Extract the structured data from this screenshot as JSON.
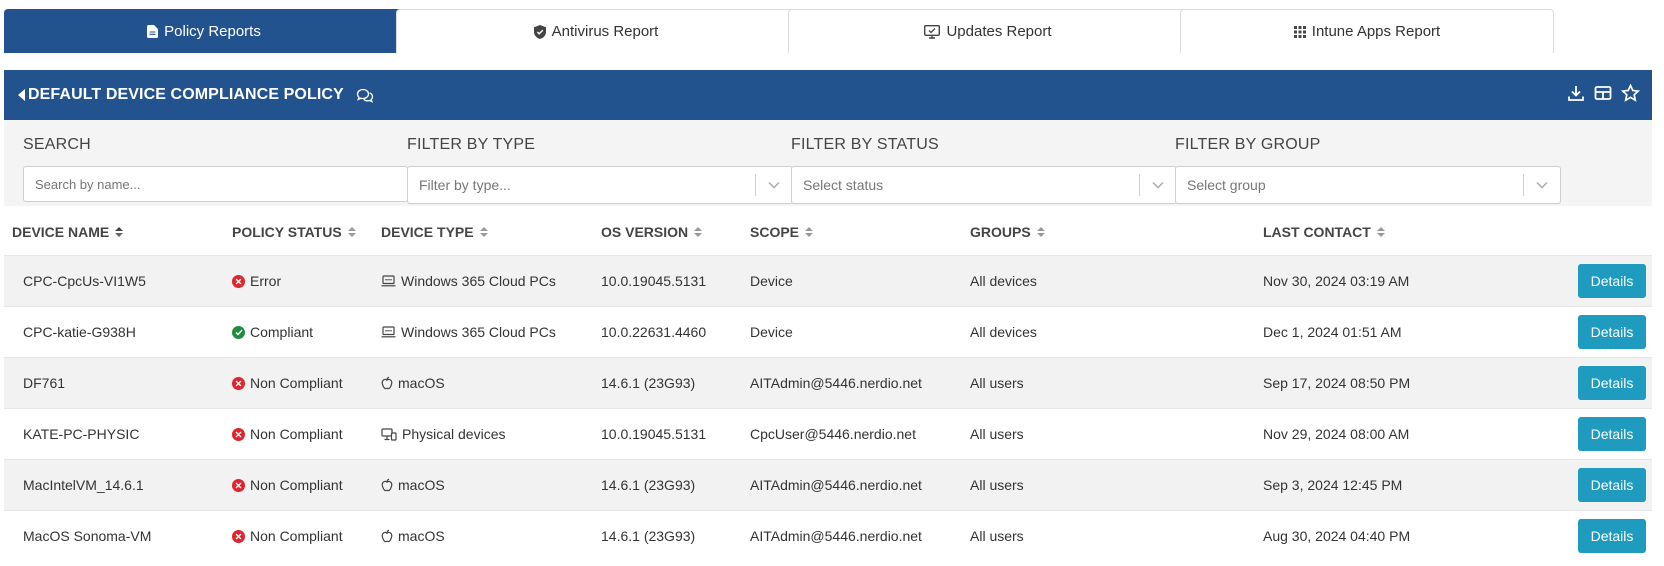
{
  "tabs": [
    {
      "label": "Policy Reports",
      "icon": "file-icon",
      "active": true
    },
    {
      "label": "Antivirus Report",
      "icon": "shield-icon",
      "active": false
    },
    {
      "label": "Updates Report",
      "icon": "monitor-icon",
      "active": false
    },
    {
      "label": "Intune Apps Report",
      "icon": "grid-icon",
      "active": false
    }
  ],
  "header": {
    "title": "DEFAULT DEVICE COMPLIANCE POLICY"
  },
  "filters": {
    "search_label": "SEARCH",
    "search_placeholder": "Search by name...",
    "type_label": "FILTER BY TYPE",
    "type_placeholder": "Filter by type...",
    "status_label": "FILTER BY STATUS",
    "status_placeholder": "Select status",
    "group_label": "FILTER BY GROUP",
    "group_placeholder": "Select group"
  },
  "table": {
    "columns": [
      "DEVICE NAME",
      "POLICY STATUS",
      "DEVICE TYPE",
      "OS VERSION",
      "SCOPE",
      "GROUPS",
      "LAST CONTACT"
    ],
    "details_label": "Details",
    "rows": [
      {
        "name": "CPC-CpcUs-VI1W5",
        "status": "Error",
        "status_kind": "error",
        "type": "Windows 365 Cloud PCs",
        "type_icon": "laptop-icon",
        "os": "10.0.19045.5131",
        "scope": "Device",
        "groups": "All devices",
        "last": "Nov 30, 2024 03:19 AM"
      },
      {
        "name": "CPC-katie-G938H",
        "status": "Compliant",
        "status_kind": "ok",
        "type": "Windows 365 Cloud PCs",
        "type_icon": "laptop-icon",
        "os": "10.0.22631.4460",
        "scope": "Device",
        "groups": "All devices",
        "last": "Dec 1, 2024 01:51 AM"
      },
      {
        "name": "DF761",
        "status": "Non Compliant",
        "status_kind": "error",
        "type": "macOS",
        "type_icon": "apple-icon",
        "os": "14.6.1 (23G93)",
        "scope": "AITAdmin@5446.nerdio.net",
        "groups": "All users",
        "last": "Sep 17, 2024 08:50 PM"
      },
      {
        "name": "KATE-PC-PHYSIC",
        "status": "Non Compliant",
        "status_kind": "error",
        "type": "Physical devices",
        "type_icon": "devices-icon",
        "os": "10.0.19045.5131",
        "scope": "CpcUser@5446.nerdio.net",
        "groups": "All users",
        "last": "Nov 29, 2024 08:00 AM"
      },
      {
        "name": "MacIntelVM_14.6.1",
        "status": "Non Compliant",
        "status_kind": "error",
        "type": "macOS",
        "type_icon": "apple-icon",
        "os": "14.6.1 (23G93)",
        "scope": "AITAdmin@5446.nerdio.net",
        "groups": "All users",
        "last": "Sep 3, 2024 12:45 PM"
      },
      {
        "name": "MacOS Sonoma-VM",
        "status": "Non Compliant",
        "status_kind": "error",
        "type": "macOS",
        "type_icon": "apple-icon",
        "os": "14.6.1 (23G93)",
        "scope": "AITAdmin@5446.nerdio.net",
        "groups": "All users",
        "last": "Aug 30, 2024 04:40 PM"
      }
    ]
  },
  "colors": {
    "primary": "#23538e",
    "details_button": "#1e9bbf",
    "error": "#e0242b",
    "ok": "#1e8e3e"
  }
}
